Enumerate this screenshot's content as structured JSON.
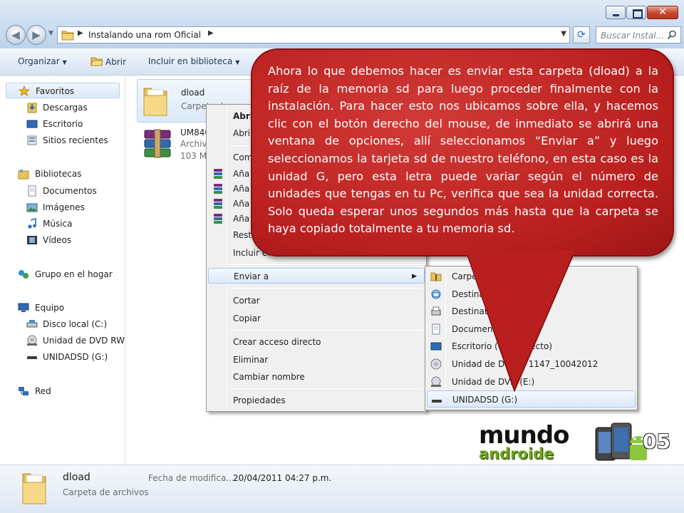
{
  "window": {
    "controls": {
      "close_glyph": "✕"
    },
    "nav": {
      "back": "◀",
      "forward": "▶",
      "dropdown": "▼"
    },
    "address": {
      "crumb": "Instalando una rom Oficial",
      "separator": "▶",
      "dropdown": "▼"
    },
    "refresh_glyph": "⟳",
    "search": {
      "placeholder": "Buscar Instal..."
    }
  },
  "toolbar": {
    "organize": "Organizar",
    "open": "Abrir",
    "include": "Incluir en biblioteca"
  },
  "navpane": {
    "favorites": "Favoritos",
    "downloads": "Descargas",
    "desktop": "Escritorio",
    "recent": "Sitios recientes",
    "libraries": "Bibliotecas",
    "documents": "Documentos",
    "images": "Imágenes",
    "music": "Música",
    "videos": "Vídeos",
    "homegroup": "Grupo en el hogar",
    "computer": "Equipo",
    "local_disk": "Disco local (C:)",
    "dvd_drive": "Unidad de DVD RW (",
    "sd_drive": "UNIDADSD (G:)",
    "network": "Red"
  },
  "files": [
    {
      "name": "dload",
      "type": "Carpeta de"
    },
    {
      "name": "UM840",
      "type": "Archiv",
      "size": "103 M"
    }
  ],
  "context_menu": {
    "items": [
      "Abrir",
      "Abrir",
      "Com",
      "Aña",
      "Aña",
      "Aña",
      "Aña",
      "Resta",
      "Incluir en",
      "Enviar a",
      "Cortar",
      "Copiar",
      "Crear acceso directo",
      "Eliminar",
      "Cambiar nombre",
      "Propiedades"
    ],
    "submenu_arrow": "▶"
  },
  "send_to": {
    "items": [
      "Carpeta co",
      "Destinatario",
      "Destinatario d",
      "Documentos",
      "Escritorio (crea         directo)",
      "Unidad de DVD          :) 1147_10042012",
      "Unidad de DVD       (E:)",
      "UNIDADSD (G:)"
    ]
  },
  "callout": {
    "text": "Ahora lo que debemos hacer es enviar esta carpeta (dload) a la raíz de la memoria sd para luego proceder finalmente con la instalación. Para hacer esto nos ubicamos sobre ella, y hacemos clic con el botón derecho del mouse, de inmediato se abrirá una ventana de opciones, allí seleccionamos “Enviar a” y luego seleccionamos la tarjeta sd de nuestro teléfono, en esta caso es la unidad G, pero esta letra puede variar según el número de unidades que tengas en tu Pc, verifica que sea la unidad correcta. Solo queda esperar unos segundos más hasta que la carpeta se haya copiado totalmente a tu memoria sd."
  },
  "details": {
    "name": "dload",
    "type": "Carpeta de archivos",
    "date_label": "Fecha de modifica...",
    "date_value": "20/04/2011 04:27 p.m."
  },
  "logo": {
    "main": "mundo",
    "sub": "androide",
    "number": "05"
  },
  "colors": {
    "callout": "#b81f1e",
    "accent": "#2a6ebd",
    "logo_green": "#6ea51c"
  }
}
